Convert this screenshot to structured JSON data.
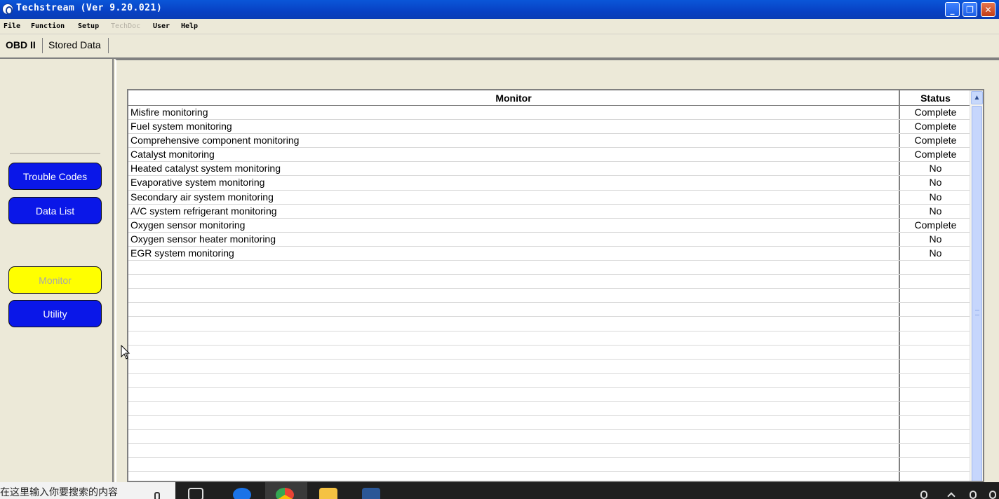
{
  "window": {
    "title": "Techstream (Ver 9.20.021)",
    "minimize_glyph": "_",
    "restore_glyph": "❐",
    "close_glyph": "✕"
  },
  "menu": [
    {
      "label": "File",
      "enabled": true
    },
    {
      "label": "Function",
      "enabled": true
    },
    {
      "label": "Setup",
      "enabled": true
    },
    {
      "label": "TechDoc",
      "enabled": false
    },
    {
      "label": "User",
      "enabled": true
    },
    {
      "label": "Help",
      "enabled": true
    }
  ],
  "tabs": [
    {
      "label": "OBD II",
      "active": true
    },
    {
      "label": "Stored Data",
      "active": false
    }
  ],
  "sidebar": {
    "buttons": [
      {
        "label": "Trouble Codes",
        "active": false
      },
      {
        "label": "Data List",
        "active": false
      },
      {
        "label": "Monitor",
        "active": true
      },
      {
        "label": "Utility",
        "active": false
      }
    ]
  },
  "table": {
    "headers": {
      "monitor": "Monitor",
      "status": "Status"
    },
    "rows": [
      {
        "monitor": "Misfire monitoring",
        "status": "Complete"
      },
      {
        "monitor": "Fuel system monitoring",
        "status": "Complete"
      },
      {
        "monitor": "Comprehensive component monitoring",
        "status": "Complete"
      },
      {
        "monitor": "Catalyst monitoring",
        "status": "Complete"
      },
      {
        "monitor": "Heated catalyst system monitoring",
        "status": "No"
      },
      {
        "monitor": "Evaporative system monitoring",
        "status": "No"
      },
      {
        "monitor": "Secondary air system monitoring",
        "status": "No"
      },
      {
        "monitor": "A/C system refrigerant monitoring",
        "status": "No"
      },
      {
        "monitor": "Oxygen sensor monitoring",
        "status": "Complete"
      },
      {
        "monitor": "Oxygen sensor heater monitoring",
        "status": "No"
      },
      {
        "monitor": "EGR system monitoring",
        "status": "No"
      }
    ]
  },
  "taskbar": {
    "search_text": "在这里输入你要搜索的内容"
  },
  "colors": {
    "nav_button": "#0a17e8",
    "nav_button_active": "#ffff00",
    "titlebar": "#0a56d8"
  }
}
